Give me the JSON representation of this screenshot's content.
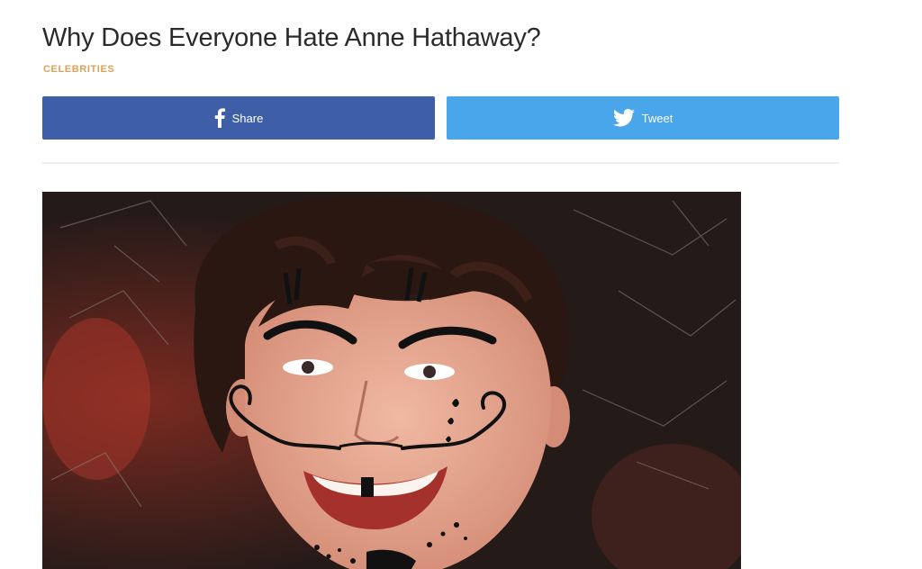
{
  "article": {
    "title": "Why Does Everyone Hate Anne Hathaway?",
    "category": "CELEBRITIES"
  },
  "share": {
    "facebook_label": "Share",
    "twitter_label": "Tweet",
    "facebook_icon": "facebook-icon",
    "twitter_icon": "twitter-bird-icon"
  },
  "colors": {
    "facebook": "#3f5ea8",
    "twitter": "#4aa6ea",
    "category": "#d9a25a",
    "title": "#2b2b2b"
  }
}
